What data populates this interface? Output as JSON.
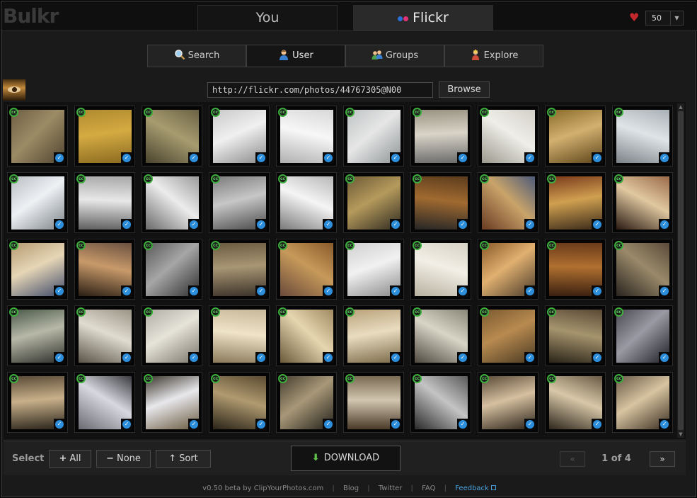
{
  "app": {
    "logo": "Bulkr"
  },
  "tabs": {
    "you": "You",
    "flickr": "Flickr"
  },
  "per_page": "50",
  "modes": [
    {
      "label": "Search",
      "icon": "magnifier-icon"
    },
    {
      "label": "User",
      "icon": "user-icon"
    },
    {
      "label": "Groups",
      "icon": "group-icon"
    },
    {
      "label": "Explore",
      "icon": "explore-icon"
    }
  ],
  "url_field": {
    "value": "http://flickr.com/photos/44767305@N00"
  },
  "browse_label": "Browse",
  "cc_badge": "cc",
  "check_glyph": "✓",
  "photos": [
    {
      "c": "#6e5f44,#9c8b65,#504431"
    },
    {
      "c": "#b08a2e,#d4aa42,#8a6a20"
    },
    {
      "c": "#6b6244,#a79c70,#4a442e"
    },
    {
      "c": "#c9c9c9,#f0f0f0,#8a8a8a"
    },
    {
      "c": "#d8d8d8,#f7f7f7,#b0b0b0"
    },
    {
      "c": "#bfc3c4,#e6e6e6,#8e9496"
    },
    {
      "c": "#9a9382,#d9d4c8,#6a6a6a"
    },
    {
      "c": "#d2d0c8,#efeee8,#9b998e"
    },
    {
      "c": "#8a6b2a,#d2b070,#5d4418"
    },
    {
      "c": "#a9b0b5,#dfe4e7,#7c8388"
    },
    {
      "c": "#b9bec4,#eef1f4,#7d8388"
    },
    {
      "c": "#a8a8a8,#e8e8e8,#5f5f5f"
    },
    {
      "c": "#9b9b9b,#ececec,#6a6a6a"
    },
    {
      "c": "#7c7c7c,#c7c7c7,#4a4a4a"
    },
    {
      "c": "#b8b8b8,#f5f5f5,#7a7a7a"
    },
    {
      "c": "#6d5a37,#b59a5c,#2f2a20"
    },
    {
      "c": "#5b3b1d,#a06a30,#262626"
    },
    {
      "c": "#4c5a7a,#c9a46a,#6a3a22"
    },
    {
      "c": "#7a3a1c,#d0a050,#3a2a1a"
    },
    {
      "c": "#9a6a4a,#e0c8a0,#2a1a12"
    },
    {
      "c": "#b59a72,#e6d6b6,#3f4a6a"
    },
    {
      "c": "#6a5040,#c89a6a,#2a1e14"
    },
    {
      "c": "#5a5a5a,#a6a6a6,#2e2e2e"
    },
    {
      "c": "#6b5a40,#a89674,#3a3128"
    },
    {
      "c": "#8a5a2a,#c79a5a,#6a4a3a"
    },
    {
      "c": "#cfcfcf,#f1f1f1,#8a8a8a"
    },
    {
      "c": "#d6d1c4,#f2efe6,#b8b1a0"
    },
    {
      "c": "#8a5a2a,#e0b070,#4a3a2a"
    },
    {
      "c": "#6a3a1a,#b07030,#3a2010"
    },
    {
      "c": "#5a4a3a,#9a8a6a,#2a2420"
    },
    {
      "c": "#4a5a4a,#b8b8a8,#2e302a"
    },
    {
      "c": "#9a9486,#e0dcd0,#5a5448"
    },
    {
      "c": "#b0ada5,#e6e3d9,#7a766a"
    },
    {
      "c": "#c8b89a,#efe3c8,#8a7a5a"
    },
    {
      "c": "#a08a62,#e6d6b0,#6a5a3a"
    },
    {
      "c": "#b9a27a,#e9dcc0,#7a6a48"
    },
    {
      "c": "#8a8678,#d8d4c6,#4e4a40"
    },
    {
      "c": "#7a5a30,#b88a50,#4a3a22"
    },
    {
      "c": "#5a4a36,#a6946e,#2a2418"
    },
    {
      "c": "#4a4a52,#9a9aa4,#1e1e24"
    },
    {
      "c": "#5a4a36,#c8b08a,#2a241a"
    },
    {
      "c": "#3a3a40,#d8d8e0,#6a6a72"
    },
    {
      "c": "#3a342a,#e8e8ec,#6a5a40"
    },
    {
      "c": "#5a4a30,#b09a70,#2a2418"
    },
    {
      "c": "#463e30,#a89878,#22201a"
    },
    {
      "c": "#7a6a52,#d2c6b0,#4a3a28"
    },
    {
      "c": "#5a5a5a,#c4c4c4,#2a2a2a"
    },
    {
      "c": "#5a4a38,#d6c0a0,#2a2218"
    },
    {
      "c": "#6a5a46,#d8c8a8,#2e261c"
    },
    {
      "c": "#6a5a48,#d8c4a0,#3a2e22"
    }
  ],
  "bottom": {
    "select_label": "Select",
    "all_label": "All",
    "none_label": "None",
    "sort_label": "Sort",
    "download_label": "DOWNLOAD",
    "prev_label": "«",
    "page_text": "1 of 4",
    "next_label": "»"
  },
  "footer": {
    "version": "v0.50 beta by",
    "author": "ClipYourPhotos.com",
    "blog": "Blog",
    "twitter": "Twitter",
    "faq": "FAQ",
    "feedback": "Feedback"
  }
}
